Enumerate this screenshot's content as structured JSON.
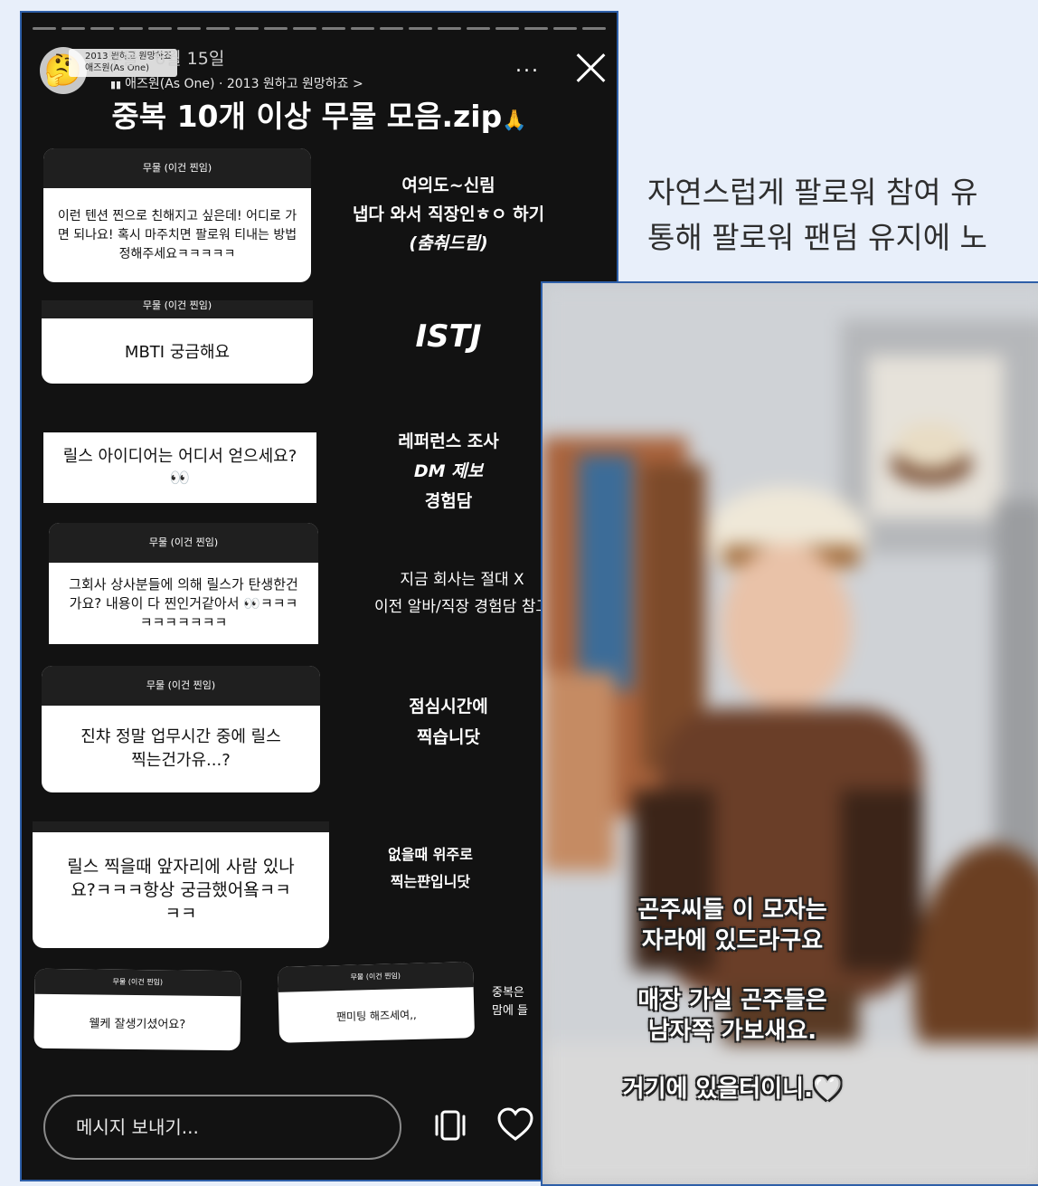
{
  "story1": {
    "username_tag": "2013 원하고 원망하죠",
    "artist_tag": "애즈원(As One)",
    "date_meta": "무물 · 6월 15일",
    "song_line": "애즈원(As One) · 2013 원하고 원망하죠 >",
    "more_label": "...",
    "title": "중복 10개 이상 무물 모음.zip",
    "title_emoji": "🙏",
    "avatar_emoji": "🤔",
    "qa": [
      {
        "header": "무물 (이건 찐임)",
        "question": "이런 텐션 찐으로 친해지고 싶은데! 어디로 가면 되나요! 혹시 마주치면 팔로워 티내는 방법 정해주세요ㅋㅋㅋㅋㅋ",
        "answer": [
          "여의도~신림",
          "냅다 와서 직장인ㅎㅇ 하기",
          "(춤춰드림)"
        ]
      },
      {
        "header": "무물 (이건 찐임)",
        "question": "MBTI 궁금해요",
        "answer": [
          "ISTJ"
        ]
      },
      {
        "header": "",
        "question": "릴스 아이디어는 어디서 얻으세요? 👀",
        "answer": [
          "레퍼런스 조사",
          "DM 제보",
          "경험담"
        ]
      },
      {
        "header": "무물 (이건 찐임)",
        "question": "그회사 상사분들에 의해 릴스가 탄생한건가요? 내용이 다 찐인거같아서 👀ㅋㅋㅋㅋㅋㅋㅋㅋㅋㅋ",
        "answer": [
          "지금 회사는 절대 X",
          "이전 알바/직장 경험담 참고"
        ]
      },
      {
        "header": "무물 (이건 찐임)",
        "question": "진챠 정말 업무시간 중에 릴스 찍는건가유...?",
        "answer": [
          "점심시간에",
          "찍습니닷"
        ]
      },
      {
        "header": "",
        "question": "릴스 찍을때 앞자리에 사람 있나요?ㅋㅋㅋ항상 궁금했어욬ㅋㅋㅋㅋ",
        "answer": [
          "없을때 위주로",
          "찍는퍈입니닷"
        ]
      },
      {
        "header": "무물 (이건 찐임)",
        "question": "웰케 잘생기셨어요?",
        "answer": []
      },
      {
        "header": "무물 (이건 찐임)",
        "question": "팬미팅 해즈세여,,",
        "answer": [
          "중복은",
          "맘에 들"
        ]
      }
    ],
    "message_placeholder": "메시지 보내기..."
  },
  "caption": {
    "line1": "자연스럽게 팔로워 참여 유",
    "line2": "통해 팔로워 팬덤 유지에 노"
  },
  "story2": {
    "subtitles": [
      "곤주씨들 이 모자는",
      "자라에 있드라구요",
      "",
      "매장 가실 곤주들은",
      "남자쪽 가보새요.",
      "",
      "거기에 있을터이니.🤍"
    ]
  },
  "colors": {
    "story_bg": "#121212",
    "page_bg": "#e8effa",
    "border": "#2e5fa8"
  }
}
